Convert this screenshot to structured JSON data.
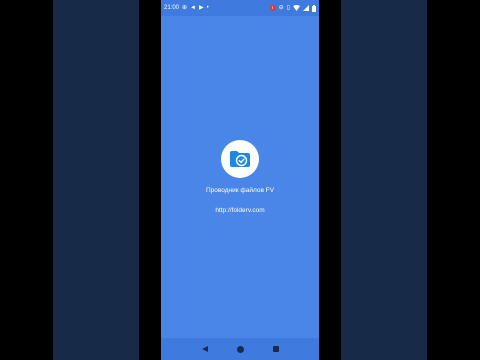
{
  "status_bar": {
    "time": "21:00",
    "left_icons": [
      "settings-circle-icon",
      "telegram-icon",
      "play-store-icon",
      "dot-icon"
    ],
    "right_icons": [
      "red-notification-icon",
      "minus-circle-icon",
      "vibrate-icon",
      "wifi-icon",
      "signal-icon",
      "battery-icon"
    ]
  },
  "splash": {
    "app_name": "Проводник файлов FV",
    "url": "http://folderv.com",
    "icon": "folder-check-icon"
  },
  "nav_bar": {
    "buttons": [
      "back-icon",
      "home-icon",
      "recents-icon"
    ]
  },
  "colors": {
    "background_panels": "#172b48",
    "screen": "#4a86e8",
    "bars": "#3f7bde",
    "icon_blue": "#1e88e5"
  }
}
